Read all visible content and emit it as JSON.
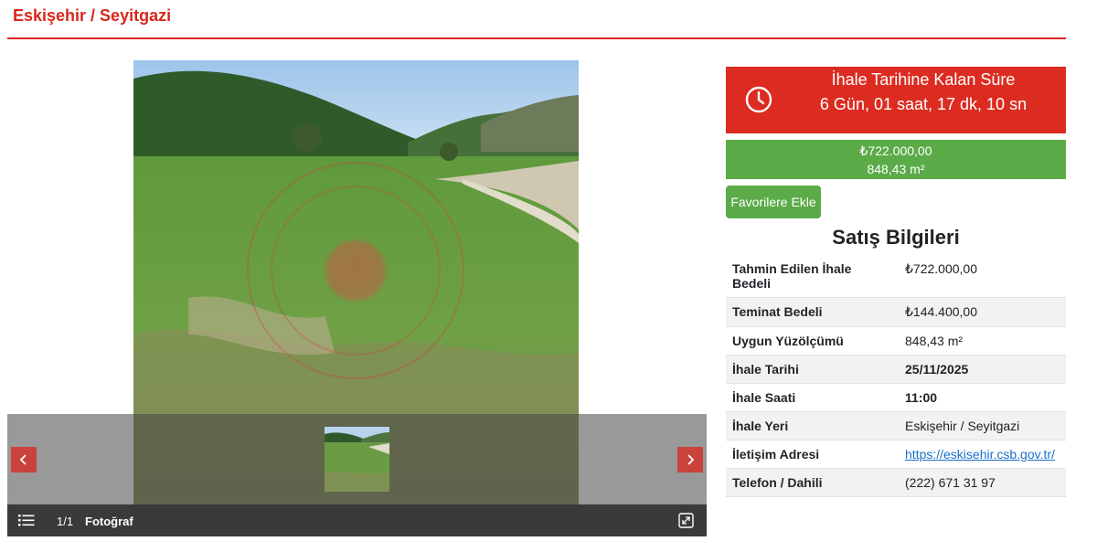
{
  "header": {
    "title": "Eskişehir / Seyitgazi"
  },
  "gallery": {
    "counter": "1/1",
    "label": "Fotoğraf",
    "prev_icon": "chevron-left-icon",
    "next_icon": "chevron-right-icon",
    "list_icon": "list-icon",
    "expand_icon": "expand-icon"
  },
  "countdown": {
    "title": "İhale Tarihine Kalan Süre",
    "value": "6 Gün, 01 saat, 17 dk, 10 sn",
    "icon": "clock-icon"
  },
  "price": {
    "amount": "₺722.000,00",
    "area": "848,43 m²"
  },
  "favorite": {
    "label": "Favorilere Ekle"
  },
  "sale_info": {
    "title": "Satış Bilgileri",
    "rows": [
      {
        "key": "Tahmin Edilen İhale Bedeli",
        "value": "₺722.000,00"
      },
      {
        "key": "Teminat Bedeli",
        "value": "₺144.400,00"
      },
      {
        "key": "Uygun Yüzölçümü",
        "value": "848,43 m²"
      },
      {
        "key": "İhale Tarihi",
        "value": "25/11/2025"
      },
      {
        "key": "İhale Saati",
        "value": "11:00"
      },
      {
        "key": "İhale Yeri",
        "value": "Eskişehir / Seyitgazi"
      },
      {
        "key": "İletişim Adresi",
        "value": "https://eskisehir.csb.gov.tr/"
      },
      {
        "key": "Telefon / Dahili",
        "value": "(222) 671 31 97"
      }
    ]
  },
  "colors": {
    "brand_red": "#dc2c21",
    "accent_green": "#5bab48",
    "link": "#1a6fc9"
  }
}
